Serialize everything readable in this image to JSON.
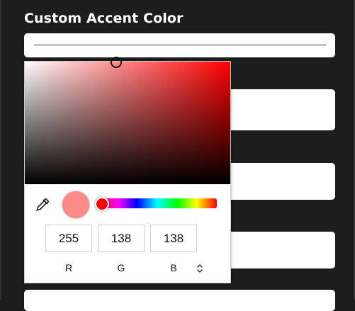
{
  "section": {
    "heading": "Custom Accent Color"
  },
  "color_picker": {
    "hue_hex": "#ff0000",
    "preview_hex": "#ff8a8a",
    "mode": "RGB",
    "channels": [
      {
        "label": "R",
        "value": "255"
      },
      {
        "label": "G",
        "value": "138"
      },
      {
        "label": "B",
        "value": "138"
      }
    ],
    "icons": {
      "eyedropper": "eyedropper-icon",
      "mode_toggle": "chevron-up-down-icon"
    }
  }
}
